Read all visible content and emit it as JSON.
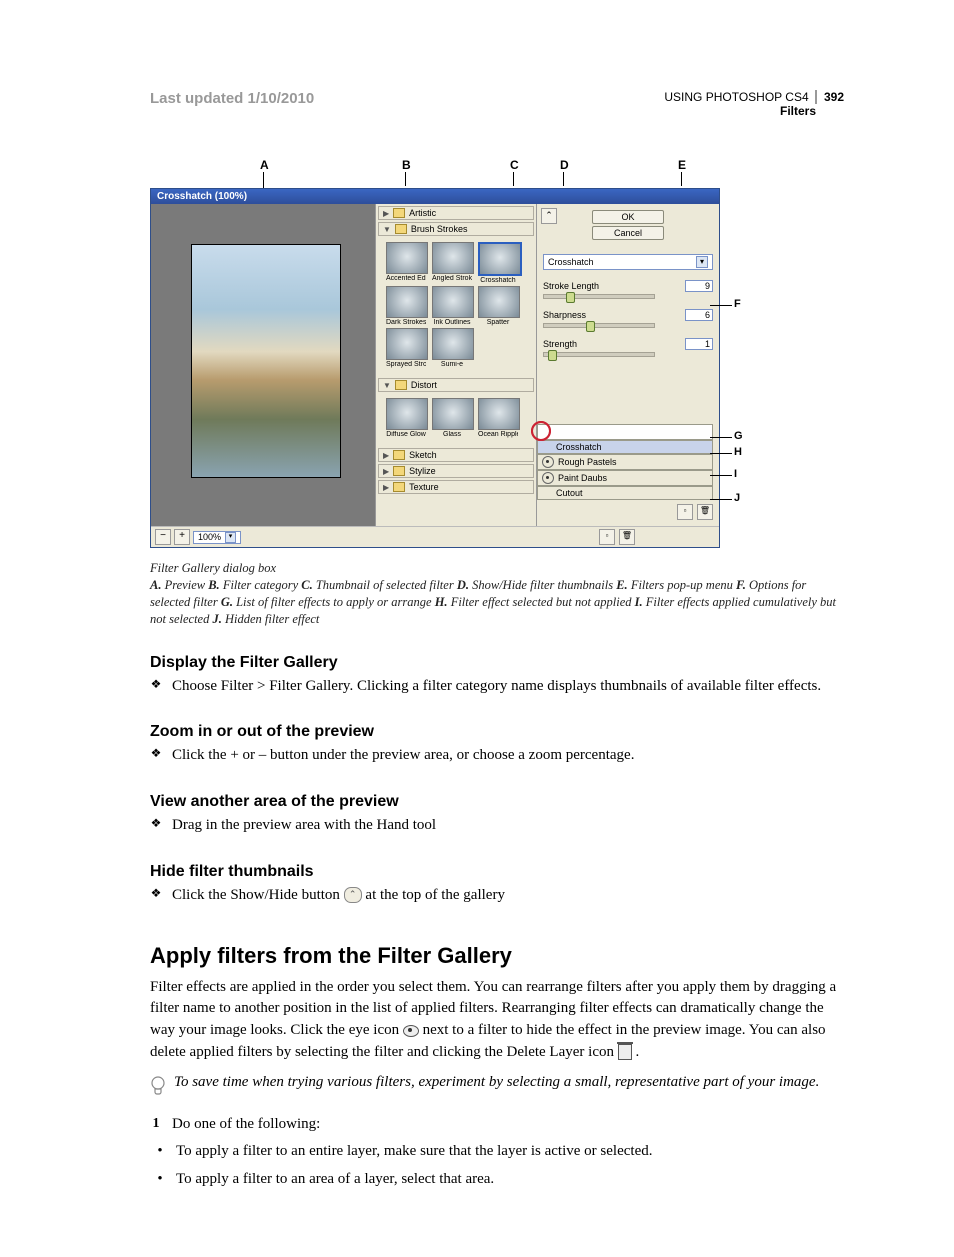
{
  "header": {
    "updated": "Last updated 1/10/2010",
    "doc_title": "USING PHOTOSHOP CS4",
    "page_number": "392",
    "section": "Filters"
  },
  "top_labels": [
    "A",
    "B",
    "C",
    "D",
    "E"
  ],
  "side_labels": [
    "F",
    "G",
    "H",
    "I",
    "J"
  ],
  "dialog": {
    "title": "Crosshatch (100%)",
    "ok": "OK",
    "cancel": "Cancel",
    "categories": {
      "artistic": "Artistic",
      "brush": "Brush Strokes",
      "distort": "Distort",
      "sketch": "Sketch",
      "stylize": "Stylize",
      "texture": "Texture"
    },
    "thumbs_brush": [
      "Accented Edges",
      "Angled Strokes",
      "Crosshatch",
      "Dark Strokes",
      "Ink Outlines",
      "Spatter",
      "Sprayed Strokes",
      "Sumi-e"
    ],
    "thumbs_distort": [
      "Diffuse Glow",
      "Glass",
      "Ocean Ripple"
    ],
    "selected_filter": "Crosshatch",
    "params": {
      "stroke_length": {
        "name": "Stroke Length",
        "value": "9"
      },
      "sharpness": {
        "name": "Sharpness",
        "value": "6"
      },
      "strength": {
        "name": "Strength",
        "value": "1"
      }
    },
    "stack": [
      "Crosshatch",
      "Rough Pastels",
      "Paint Daubs",
      "Cutout"
    ],
    "zoom": "100%"
  },
  "caption": {
    "title": "Filter Gallery dialog box",
    "items": [
      {
        "k": "A.",
        "t": "Preview"
      },
      {
        "k": "B.",
        "t": "Filter category"
      },
      {
        "k": "C.",
        "t": "Thumbnail of selected filter"
      },
      {
        "k": "D.",
        "t": "Show/Hide filter thumbnails"
      },
      {
        "k": "E.",
        "t": "Filters pop-up menu"
      },
      {
        "k": "F.",
        "t": "Options for selected filter"
      },
      {
        "k": "G.",
        "t": "List of filter effects to apply or arrange"
      },
      {
        "k": "H.",
        "t": "Filter effect selected but not applied"
      },
      {
        "k": "I.",
        "t": "Filter effects applied cumulatively but not selected"
      },
      {
        "k": "J.",
        "t": "Hidden filter effect"
      }
    ]
  },
  "sections": {
    "display": {
      "h": "Display the Filter Gallery",
      "p": "Choose Filter > Filter Gallery. Clicking a filter category name displays thumbnails of available filter effects."
    },
    "zoom": {
      "h": "Zoom in or out of the preview",
      "p": "Click the + or – button under the preview area, or choose a zoom percentage."
    },
    "view": {
      "h": "View another area of the preview",
      "p": "Drag in the preview area with the Hand tool"
    },
    "hide": {
      "h": "Hide filter thumbnails",
      "p_before": "Click the Show/Hide button ",
      "p_after": " at the top of the gallery"
    },
    "apply": {
      "h": "Apply filters from the Filter Gallery",
      "p1a": "Filter effects are applied in the order you select them. You can rearrange filters after you apply them by dragging a filter name to another position in the list of applied filters. Rearranging filter effects can dramatically change the way your image looks. Click the eye icon ",
      "p1b": " next to a filter to hide the effect in the preview image. You can also delete applied filters by selecting the filter and clicking the Delete Layer icon ",
      "p1c": " .",
      "tip": "To save time when trying various filters, experiment by selecting a small, representative part of your image.",
      "step1": "Do one of the following:",
      "b1": "To apply a filter to an entire layer, make sure that the layer is active or selected.",
      "b2": "To apply a filter to an area of a layer, select that area."
    }
  }
}
